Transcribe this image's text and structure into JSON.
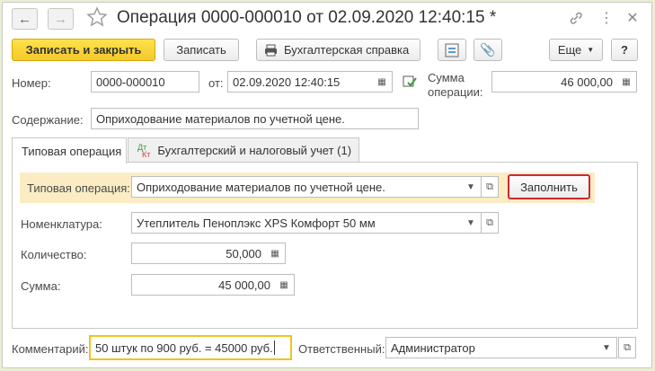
{
  "header": {
    "title": "Операция 0000-000010 от 02.09.2020 12:40:15 *"
  },
  "toolbar": {
    "save_close": "Записать и закрыть",
    "save": "Записать",
    "report": "Бухгалтерская справка",
    "more": "Еще",
    "help": "?"
  },
  "form": {
    "number_label": "Номер:",
    "number_value": "0000-000010",
    "from_label": "от:",
    "date_value": "02.09.2020 12:40:15",
    "sum_label_1": "Сумма",
    "sum_label_2": "операции:",
    "sum_value": "46 000,00",
    "content_label": "Содержание:",
    "content_value": "Оприходование материалов по учетной цене."
  },
  "tabs": [
    {
      "label": "Типовая операция"
    },
    {
      "label": "Бухгалтерский и налоговый учет (1)",
      "icon_top": "Дт",
      "icon_bottom": "Кт"
    }
  ],
  "panel": {
    "op_label": "Типовая операция:",
    "op_value": "Оприходование материалов по учетной цене.",
    "fill_button": "Заполнить",
    "nomen_label": "Номенклатура:",
    "nomen_value": "Утеплитель Пеноплэкс XPS Комфорт 50 мм",
    "qty_label": "Количество:",
    "qty_value": "50,000",
    "amount_label": "Сумма:",
    "amount_value": "45 000,00"
  },
  "footer": {
    "comment_label": "Комментарий:",
    "comment_value": "50 штук по 900 руб. = 45000 руб.",
    "responsible_label": "Ответственный:",
    "responsible_value": "Администратор"
  },
  "colors": {
    "primary_button": "#f5c82a",
    "highlight_row": "#fbecc4",
    "fill_button_border": "#d0282e",
    "comment_border": "#f0c419"
  }
}
